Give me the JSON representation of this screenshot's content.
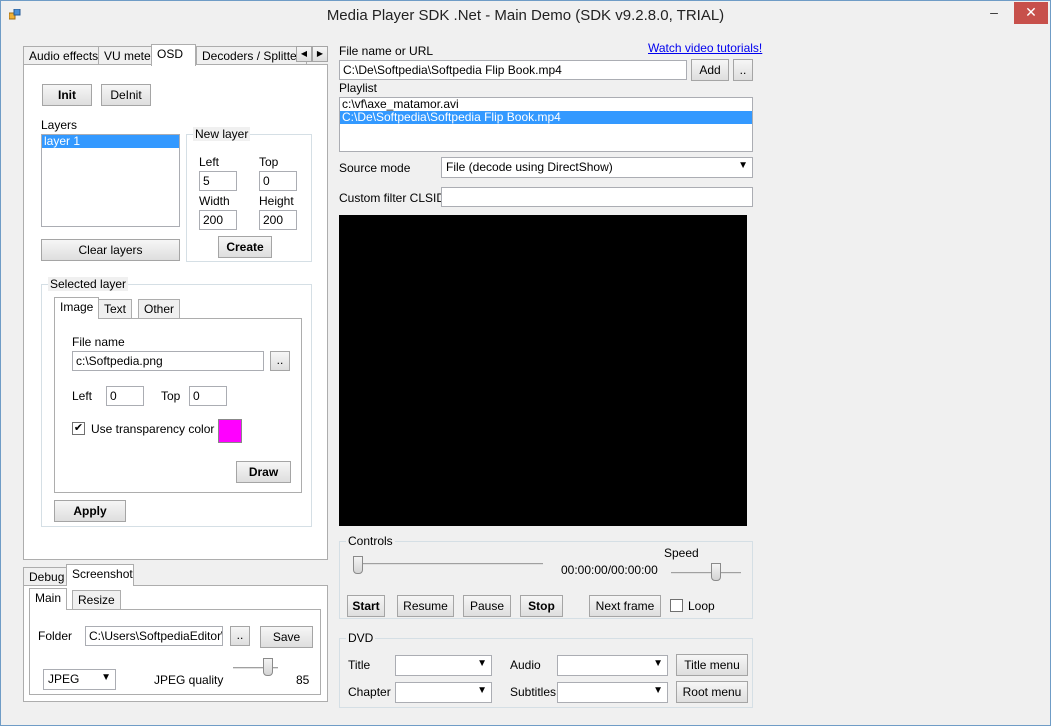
{
  "window": {
    "title": "Media Player SDK .Net - Main Demo (SDK v9.2.8.0, TRIAL)",
    "minimize": "–",
    "close": "✕"
  },
  "top_tabs": [
    "Audio effects",
    "VU meter",
    "OSD",
    "Decoders / Splitter"
  ],
  "osd": {
    "init": "Init",
    "deinit": "DeInit",
    "layers_label": "Layers",
    "layers": [
      "layer 1"
    ],
    "clear_layers": "Clear layers",
    "new_layer": {
      "title": "New layer",
      "left_label": "Left",
      "top_label": "Top",
      "width_label": "Width",
      "height_label": "Height",
      "left": "5",
      "top": "0",
      "width": "200",
      "height": "200",
      "create": "Create"
    },
    "selected_layer": {
      "title": "Selected layer",
      "tabs": [
        "Image",
        "Text",
        "Other"
      ],
      "file_name_label": "File name",
      "file_name": "c:\\Softpedia.png",
      "browse": "..",
      "left_label": "Left",
      "left": "0",
      "top_label": "Top",
      "top": "0",
      "use_transparency": "Use transparency color",
      "transparency_color": "#ff00ff",
      "draw": "Draw",
      "apply": "Apply"
    }
  },
  "bottom_tabs": [
    "Debug",
    "Screenshot"
  ],
  "screenshot": {
    "tabs": [
      "Main",
      "Resize"
    ],
    "folder_label": "Folder",
    "folder": "C:\\Users\\SoftpediaEditor\\Do",
    "browse": "..",
    "save": "Save",
    "format": "JPEG",
    "quality_label": "JPEG quality",
    "quality": 85
  },
  "file": {
    "label": "File name or URL",
    "value": "C:\\De\\Softpedia\\Softpedia Flip Book.mp4",
    "add": "Add",
    "browse": "..",
    "tutorials": "Watch video tutorials!"
  },
  "playlist": {
    "label": "Playlist",
    "items": [
      "c:\\vf\\axe_matamor.avi",
      "C:\\De\\Softpedia\\Softpedia Flip Book.mp4"
    ],
    "selected": 1
  },
  "source_mode": {
    "label": "Source mode",
    "value": "File (decode using DirectShow)"
  },
  "custom_filter": {
    "label": "Custom filter CLSID",
    "value": ""
  },
  "controls": {
    "title": "Controls",
    "time": "00:00:00/00:00:00",
    "speed_label": "Speed",
    "start": "Start",
    "resume": "Resume",
    "pause": "Pause",
    "stop": "Stop",
    "next_frame": "Next frame",
    "loop": "Loop"
  },
  "dvd": {
    "title": "DVD",
    "title_label": "Title",
    "chapter_label": "Chapter",
    "audio_label": "Audio",
    "subtitles_label": "Subtitles",
    "title_menu": "Title menu",
    "root_menu": "Root menu"
  }
}
